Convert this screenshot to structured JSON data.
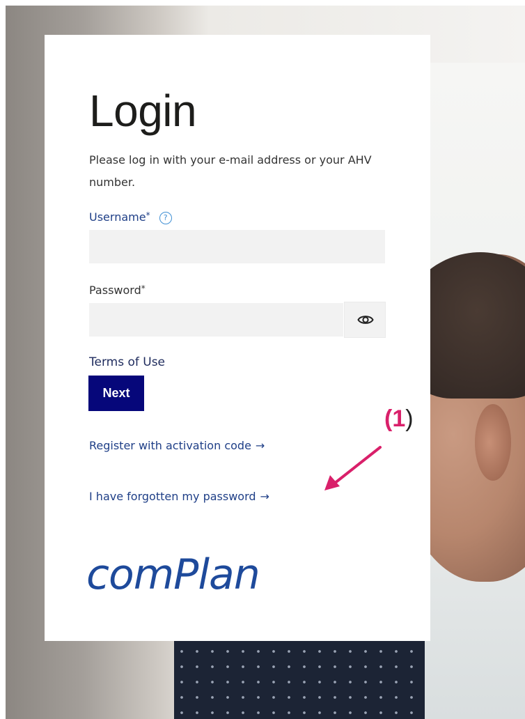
{
  "login": {
    "title": "Login",
    "intro": "Please log in with your e-mail address or your AHV number.",
    "username_label": "Username",
    "password_label": "Password",
    "required_marker": "*",
    "help_glyph": "?",
    "username_value": "",
    "password_value": "",
    "terms_link": "Terms of Use",
    "next_button": "Next",
    "register_link": "Register with activation code",
    "forgot_link": "I have forgotten my password",
    "link_arrow": "→"
  },
  "branding": {
    "logo_text": "comPlan",
    "logo_color": "#1e4a9b"
  },
  "annotation": {
    "open": "(",
    "number": "1",
    "close": ")",
    "color": "#d9206a"
  },
  "icons": {
    "help": "question-circle-icon",
    "eye": "eye-icon"
  },
  "colors": {
    "primary_button": "#06077a",
    "link": "#1f3f87",
    "input_background": "#f2f2f2"
  }
}
